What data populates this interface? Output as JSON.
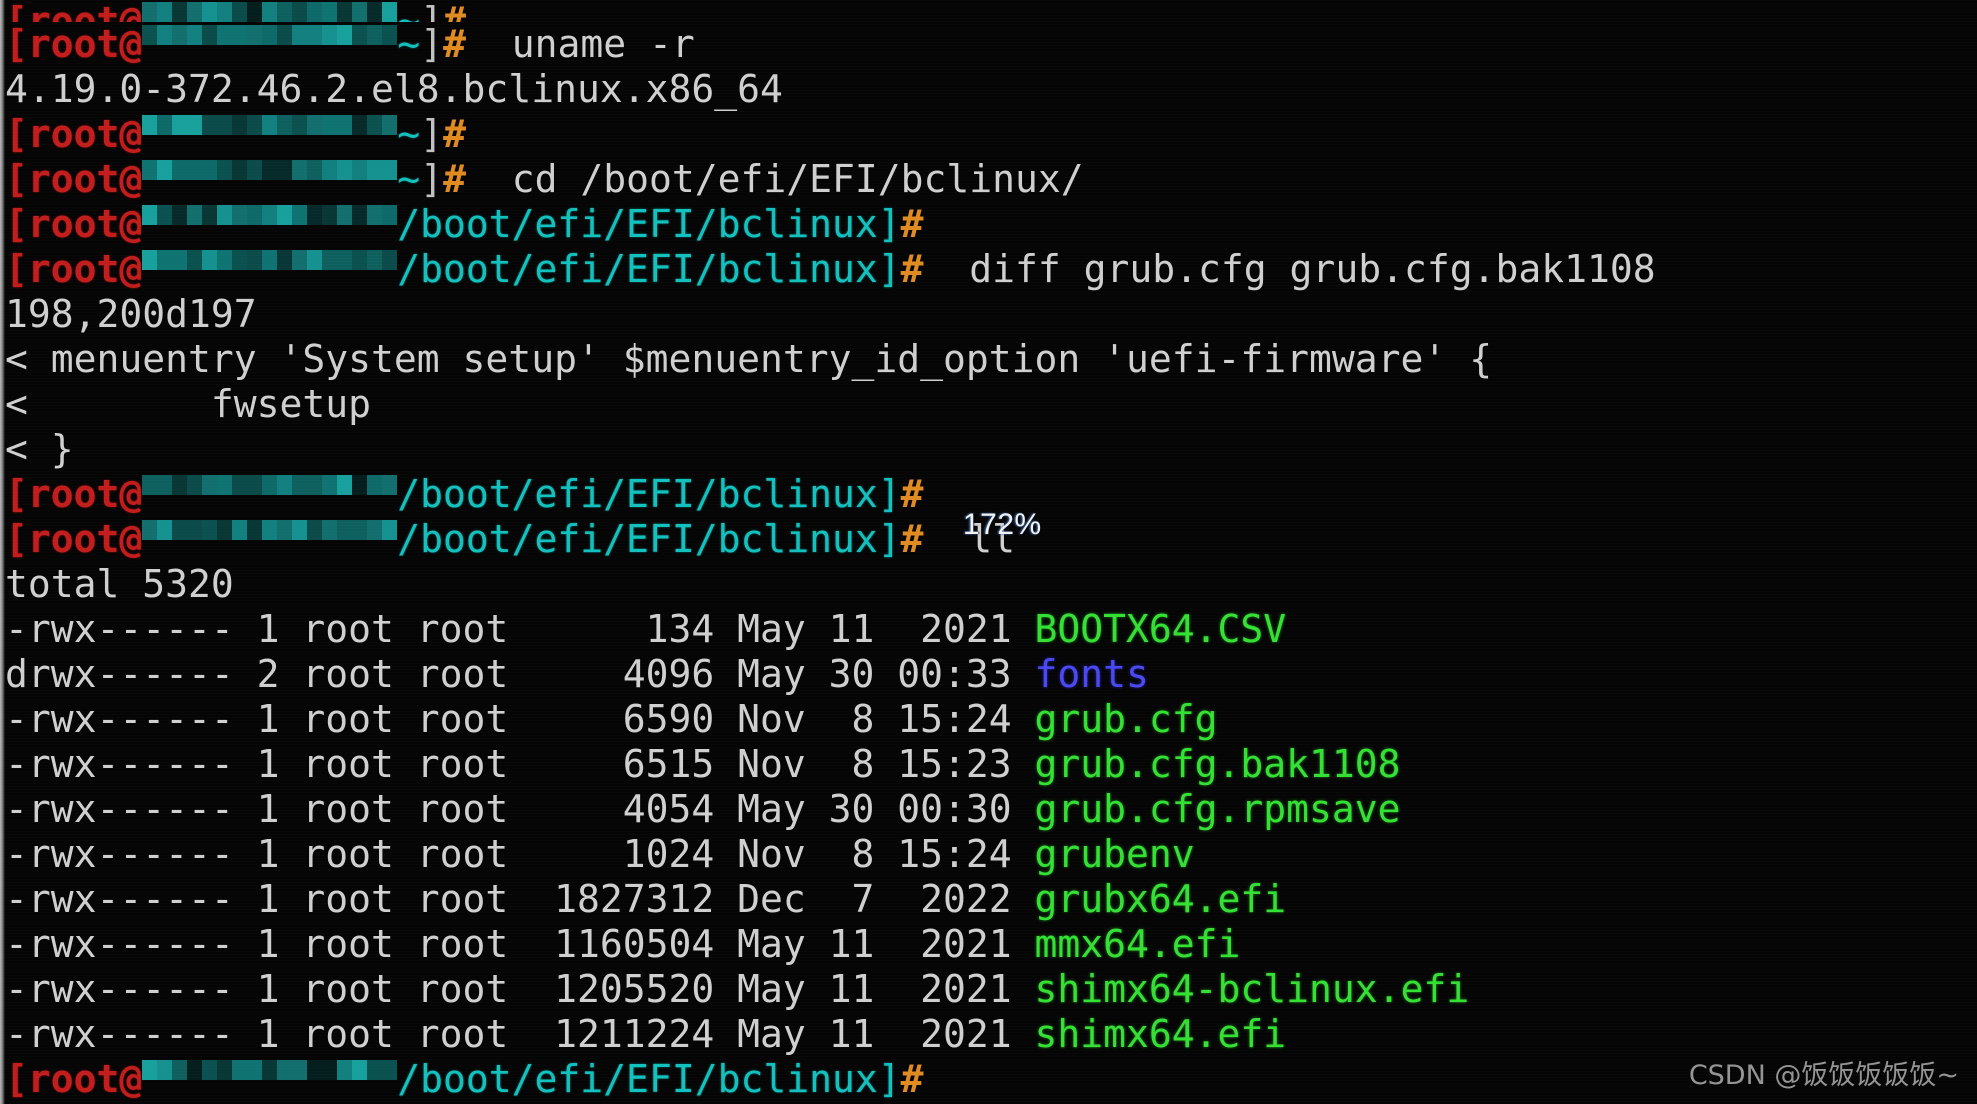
{
  "terminal": {
    "zoom_badge": "172%",
    "watermark": "CSDN @饭饭饭饭饭~",
    "prompt": {
      "user": "[root@",
      "host_redacted": "REDACTED",
      "home_cwd": "~",
      "path_cwd": "/boot/efi/EFI/bclinux",
      "close_bracket": "]",
      "sigil": "#"
    },
    "commands": {
      "uname": "uname -r",
      "cd": "cd /boot/efi/EFI/bclinux/",
      "diff": "diff grub.cfg grub.cfg.bak1108",
      "ll": "ll"
    },
    "output": {
      "kernel_release": "4.19.0-372.46.2.el8.bclinux.x86_64",
      "diff_hunk_header": "198,200d197",
      "diff_lines": [
        "< menuentry 'System setup' $menuentry_id_option 'uefi-firmware' {",
        "<        fwsetup",
        "< }"
      ],
      "ls_total": "total 5320",
      "ls_rows": [
        {
          "perms": "-rwx------",
          "links": "1",
          "owner": "root",
          "group": "root",
          "size": "134",
          "month": "May",
          "day": "11",
          "time": "2021",
          "name": "BOOTX64.CSV",
          "kind": "exec"
        },
        {
          "perms": "drwx------",
          "links": "2",
          "owner": "root",
          "group": "root",
          "size": "4096",
          "month": "May",
          "day": "30",
          "time": "00:33",
          "name": "fonts",
          "kind": "dir"
        },
        {
          "perms": "-rwx------",
          "links": "1",
          "owner": "root",
          "group": "root",
          "size": "6590",
          "month": "Nov",
          "day": "8",
          "time": "15:24",
          "name": "grub.cfg",
          "kind": "exec"
        },
        {
          "perms": "-rwx------",
          "links": "1",
          "owner": "root",
          "group": "root",
          "size": "6515",
          "month": "Nov",
          "day": "8",
          "time": "15:23",
          "name": "grub.cfg.bak1108",
          "kind": "exec"
        },
        {
          "perms": "-rwx------",
          "links": "1",
          "owner": "root",
          "group": "root",
          "size": "4054",
          "month": "May",
          "day": "30",
          "time": "00:30",
          "name": "grub.cfg.rpmsave",
          "kind": "exec"
        },
        {
          "perms": "-rwx------",
          "links": "1",
          "owner": "root",
          "group": "root",
          "size": "1024",
          "month": "Nov",
          "day": "8",
          "time": "15:24",
          "name": "grubenv",
          "kind": "exec"
        },
        {
          "perms": "-rwx------",
          "links": "1",
          "owner": "root",
          "group": "root",
          "size": "1827312",
          "month": "Dec",
          "day": "7",
          "time": "2022",
          "name": "grubx64.efi",
          "kind": "exec"
        },
        {
          "perms": "-rwx------",
          "links": "1",
          "owner": "root",
          "group": "root",
          "size": "1160504",
          "month": "May",
          "day": "11",
          "time": "2021",
          "name": "mmx64.efi",
          "kind": "exec"
        },
        {
          "perms": "-rwx------",
          "links": "1",
          "owner": "root",
          "group": "root",
          "size": "1205520",
          "month": "May",
          "day": "11",
          "time": "2021",
          "name": "shimx64-bclinux.efi",
          "kind": "exec"
        },
        {
          "perms": "-rwx------",
          "links": "1",
          "owner": "root",
          "group": "root",
          "size": "1211224",
          "month": "May",
          "day": "11",
          "time": "2021",
          "name": "shimx64.efi",
          "kind": "exec"
        }
      ]
    },
    "colors": {
      "background": "#050505",
      "foreground": "#c8c8c8",
      "user_red": "#c21d1d",
      "path_teal": "#12c1bd",
      "sigil_orange": "#e08a22",
      "exec_green": "#35e035",
      "dir_blue": "#4a49f0",
      "redaction_teal": "#0f7a78"
    }
  }
}
